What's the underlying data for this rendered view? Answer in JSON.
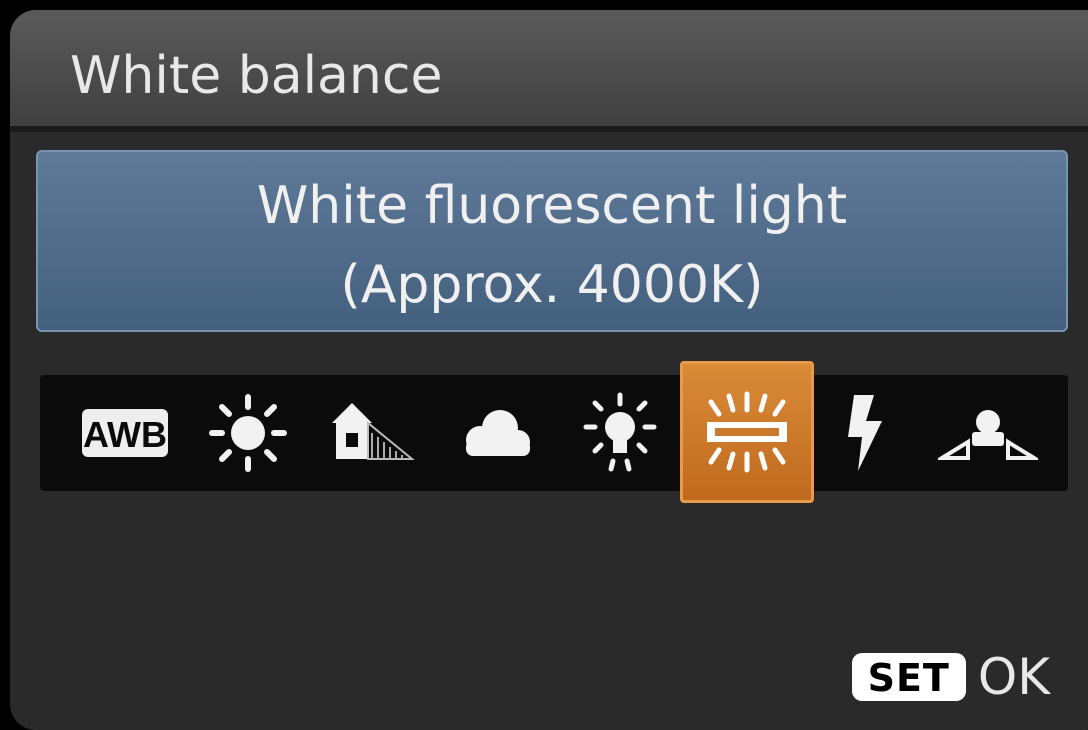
{
  "header": {
    "title": "White balance"
  },
  "selected_mode": {
    "name": "White fluorescent light",
    "temperature": "(Approx. 4000K)"
  },
  "icons": [
    {
      "id": "awb",
      "label": "AWB",
      "icon": "auto-white-balance-icon"
    },
    {
      "id": "daylight",
      "icon": "sun-icon"
    },
    {
      "id": "shade",
      "icon": "shade-house-icon"
    },
    {
      "id": "cloudy",
      "icon": "cloud-icon"
    },
    {
      "id": "tungsten",
      "icon": "tungsten-bulb-icon"
    },
    {
      "id": "fluorescent",
      "icon": "fluorescent-light-icon",
      "selected": true
    },
    {
      "id": "flash",
      "icon": "flash-bolt-icon"
    },
    {
      "id": "custom",
      "icon": "custom-wb-icon"
    }
  ],
  "footer": {
    "set_label": "SET",
    "ok_label": "OK"
  },
  "colors": {
    "selected_bg": "#d1802f",
    "mode_box_bg": "#52708f",
    "screen_bg": "#2a2a2a"
  }
}
